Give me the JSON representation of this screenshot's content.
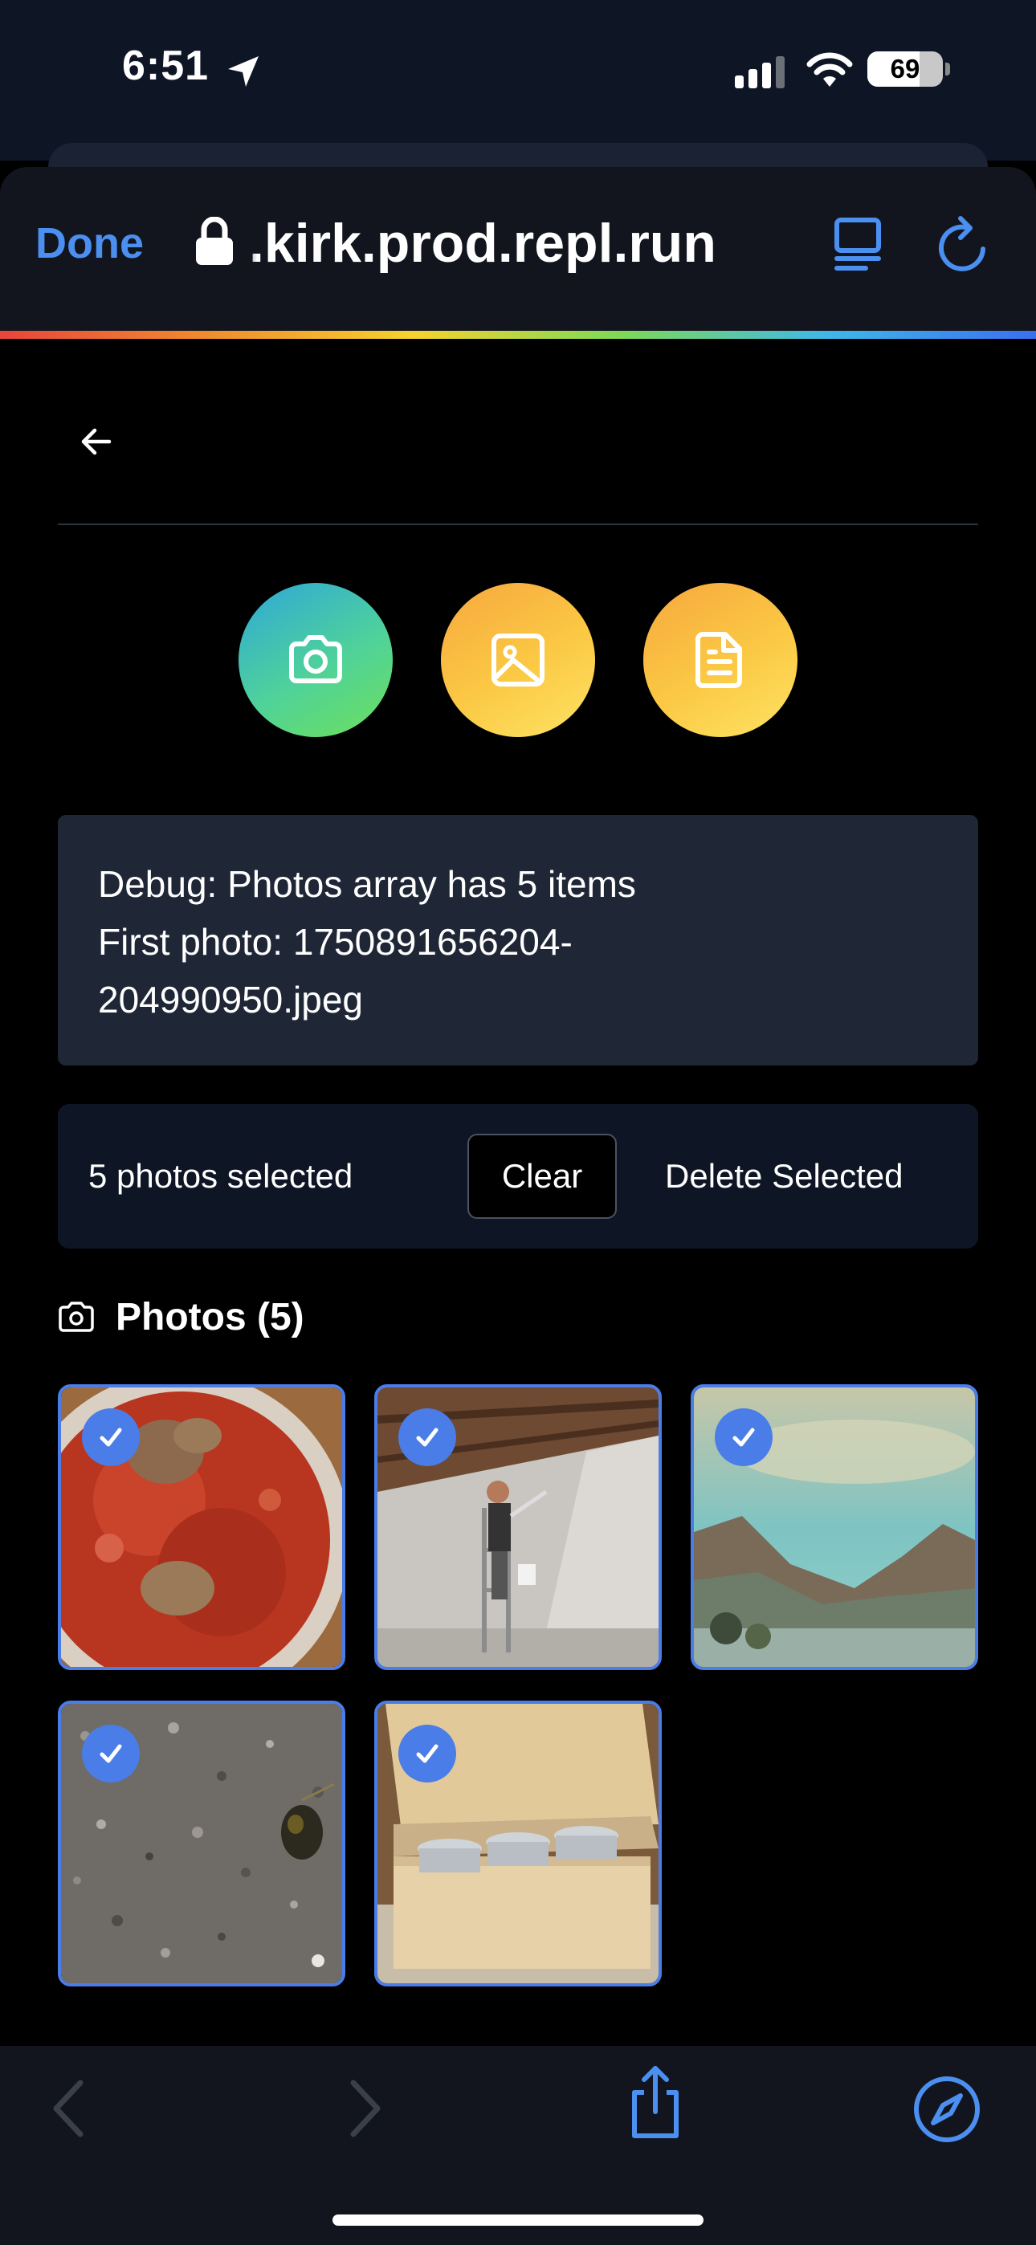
{
  "status_bar": {
    "time": "6:51",
    "battery_level": "69",
    "battery_fraction": 0.69
  },
  "browser": {
    "done_label": "Done",
    "url": ".kirk.prod.repl.run"
  },
  "upload_actions": [
    {
      "icon": "camera-icon"
    },
    {
      "icon": "image-icon"
    },
    {
      "icon": "document-icon"
    }
  ],
  "debug": {
    "line1": "Debug: Photos array has 5 items",
    "line2": "First photo: 1750891656204-",
    "line3": "204990950.jpeg"
  },
  "selection": {
    "count_label": "5 photos selected",
    "clear_label": "Clear",
    "delete_label": "Delete Selected"
  },
  "photos": {
    "title": "Photos (5)",
    "accent_color": "#4a7de8",
    "items": [
      {
        "subject": "plate of pasta with meatballs",
        "selected": true
      },
      {
        "subject": "painter on ladder spraying wall",
        "selected": true
      },
      {
        "subject": "mountain landscape painting",
        "selected": true
      },
      {
        "subject": "gravel ground close-up",
        "selected": true
      },
      {
        "subject": "wooden chest with buckets",
        "selected": true
      }
    ]
  },
  "toolbar": {
    "icons": [
      "back-icon",
      "forward-icon",
      "share-icon",
      "compass-icon"
    ]
  }
}
